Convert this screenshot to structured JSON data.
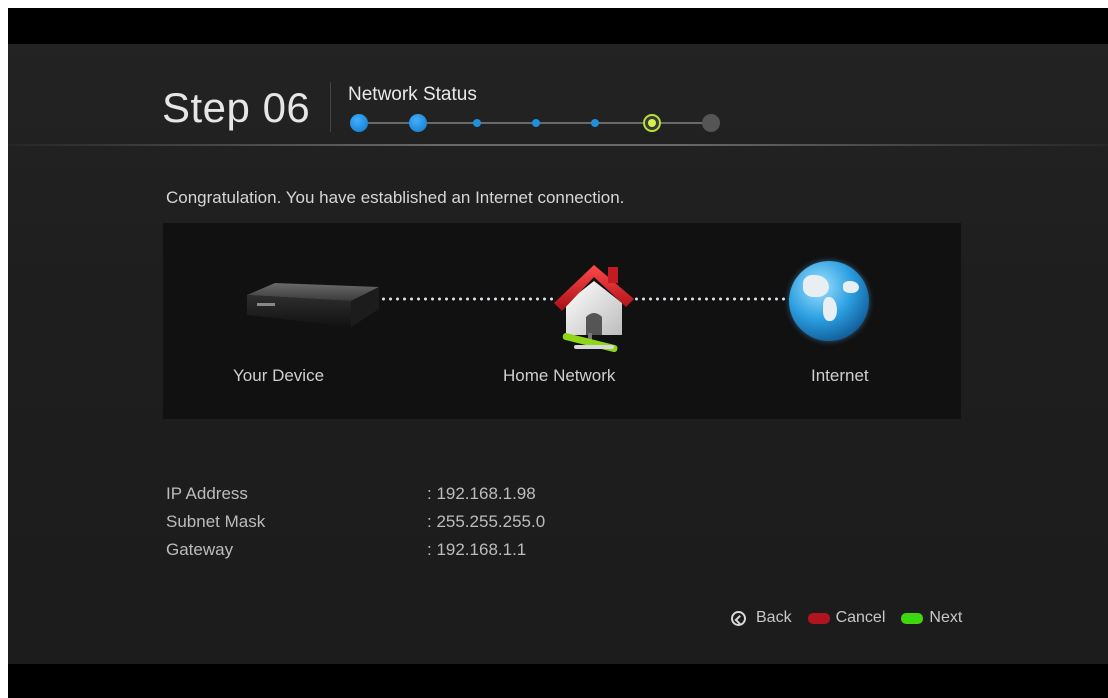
{
  "header": {
    "step": "Step 06",
    "step_name": "Network Status",
    "progress": {
      "total": 7,
      "current": 6
    }
  },
  "message": "Congratulation. You have established an Internet connection.",
  "diagram": {
    "nodes": [
      "Your Device",
      "Home Network",
      "Internet"
    ]
  },
  "network_info": [
    {
      "label": "IP Address",
      "value": ": 192.168.1.98"
    },
    {
      "label": "Subnet Mask",
      "value": ": 255.255.255.0"
    },
    {
      "label": "Gateway",
      "value": ": 192.168.1.1"
    }
  ],
  "footer": {
    "back_label": "Back",
    "cancel_label": "Cancel",
    "next_label": "Next",
    "cancel_color": "#b0141e",
    "next_color": "#3ed60e"
  }
}
